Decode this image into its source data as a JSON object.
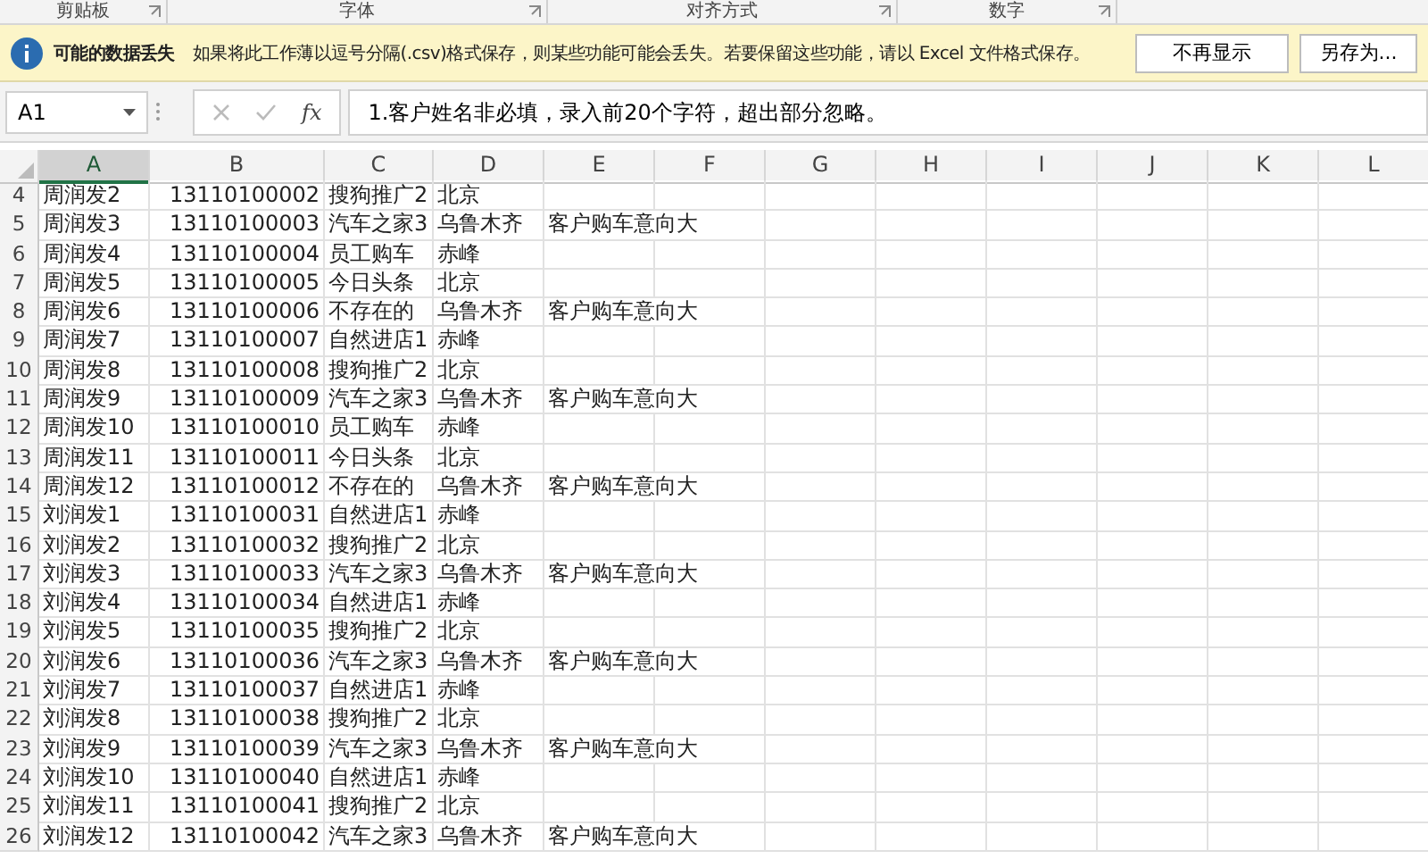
{
  "ribbon_groups": [
    {
      "label": "剪贴板"
    },
    {
      "label": "字体"
    },
    {
      "label": "对齐方式"
    },
    {
      "label": "数字"
    }
  ],
  "message_bar": {
    "title": "可能的数据丢失",
    "message": "如果将此工作薄以逗号分隔(.csv)格式保存，则某些功能可能会丢失。若要保留这些功能，请以 Excel 文件格式保存。",
    "buttons": [
      "不再显示",
      "另存为..."
    ]
  },
  "formula_bar": {
    "name_box": "A1",
    "fx": "fx",
    "formula": "1.客户姓名非必填，录入前20个字符，超出部分忽略。"
  },
  "sheet": {
    "columns": [
      {
        "label": "A",
        "selected": true
      },
      {
        "label": "B",
        "selected": false
      },
      {
        "label": "C",
        "selected": false
      },
      {
        "label": "D",
        "selected": false
      },
      {
        "label": "E",
        "selected": false
      },
      {
        "label": "F",
        "selected": false
      },
      {
        "label": "G",
        "selected": false
      },
      {
        "label": "H",
        "selected": false
      },
      {
        "label": "I",
        "selected": false
      },
      {
        "label": "J",
        "selected": false
      },
      {
        "label": "K",
        "selected": false
      },
      {
        "label": "L",
        "selected": false
      }
    ],
    "rows": [
      {
        "number": "4",
        "cells": [
          "周润发2",
          "13110100002",
          "搜狗推广2",
          "北京",
          ""
        ]
      },
      {
        "number": "5",
        "cells": [
          "周润发3",
          "13110100003",
          "汽车之家3",
          "乌鲁木齐",
          "客户购车意向大"
        ]
      },
      {
        "number": "6",
        "cells": [
          "周润发4",
          "13110100004",
          "员工购车",
          "赤峰",
          ""
        ]
      },
      {
        "number": "7",
        "cells": [
          "周润发5",
          "13110100005",
          "今日头条",
          "北京",
          ""
        ]
      },
      {
        "number": "8",
        "cells": [
          "周润发6",
          "13110100006",
          "不存在的",
          "乌鲁木齐",
          "客户购车意向大"
        ]
      },
      {
        "number": "9",
        "cells": [
          "周润发7",
          "13110100007",
          "自然进店1",
          "赤峰",
          ""
        ]
      },
      {
        "number": "10",
        "cells": [
          "周润发8",
          "13110100008",
          "搜狗推广2",
          "北京",
          ""
        ]
      },
      {
        "number": "11",
        "cells": [
          "周润发9",
          "13110100009",
          "汽车之家3",
          "乌鲁木齐",
          "客户购车意向大"
        ]
      },
      {
        "number": "12",
        "cells": [
          "周润发10",
          "13110100010",
          "员工购车",
          "赤峰",
          ""
        ]
      },
      {
        "number": "13",
        "cells": [
          "周润发11",
          "13110100011",
          "今日头条",
          "北京",
          ""
        ]
      },
      {
        "number": "14",
        "cells": [
          "周润发12",
          "13110100012",
          "不存在的",
          "乌鲁木齐",
          "客户购车意向大"
        ]
      },
      {
        "number": "15",
        "cells": [
          "刘润发1",
          "13110100031",
          "自然进店1",
          "赤峰",
          ""
        ]
      },
      {
        "number": "16",
        "cells": [
          "刘润发2",
          "13110100032",
          "搜狗推广2",
          "北京",
          ""
        ]
      },
      {
        "number": "17",
        "cells": [
          "刘润发3",
          "13110100033",
          "汽车之家3",
          "乌鲁木齐",
          "客户购车意向大"
        ]
      },
      {
        "number": "18",
        "cells": [
          "刘润发4",
          "13110100034",
          "自然进店1",
          "赤峰",
          ""
        ]
      },
      {
        "number": "19",
        "cells": [
          "刘润发5",
          "13110100035",
          "搜狗推广2",
          "北京",
          ""
        ]
      },
      {
        "number": "20",
        "cells": [
          "刘润发6",
          "13110100036",
          "汽车之家3",
          "乌鲁木齐",
          "客户购车意向大"
        ]
      },
      {
        "number": "21",
        "cells": [
          "刘润发7",
          "13110100037",
          "自然进店1",
          "赤峰",
          ""
        ]
      },
      {
        "number": "22",
        "cells": [
          "刘润发8",
          "13110100038",
          "搜狗推广2",
          "北京",
          ""
        ]
      },
      {
        "number": "23",
        "cells": [
          "刘润发9",
          "13110100039",
          "汽车之家3",
          "乌鲁木齐",
          "客户购车意向大"
        ]
      },
      {
        "number": "24",
        "cells": [
          "刘润发10",
          "13110100040",
          "自然进店1",
          "赤峰",
          ""
        ]
      },
      {
        "number": "25",
        "cells": [
          "刘润发11",
          "13110100041",
          "搜狗推广2",
          "北京",
          ""
        ]
      },
      {
        "number": "26",
        "cells": [
          "刘润发12",
          "13110100042",
          "汽车之家3",
          "乌鲁木齐",
          "客户购车意向大"
        ]
      }
    ]
  }
}
